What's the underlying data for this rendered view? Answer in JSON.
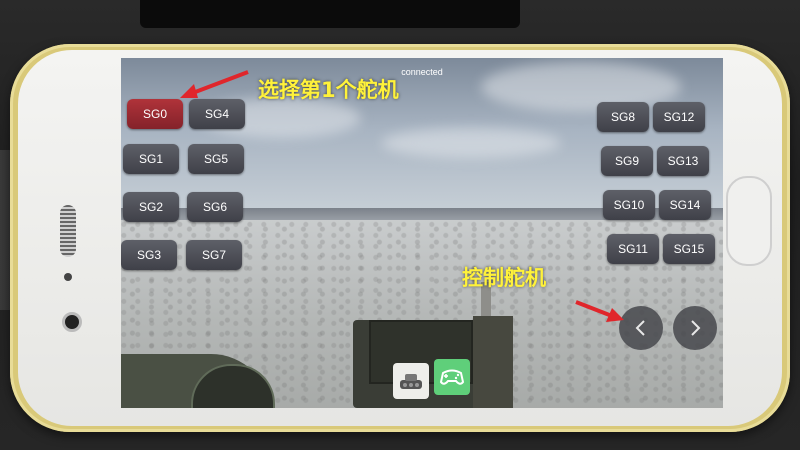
{
  "screen": {
    "status_text": "connected"
  },
  "left_buttons": [
    {
      "label": "SG0",
      "active": true
    },
    {
      "label": "SG4",
      "active": false
    },
    {
      "label": "SG1",
      "active": false
    },
    {
      "label": "SG5",
      "active": false
    },
    {
      "label": "SG2",
      "active": false
    },
    {
      "label": "SG6",
      "active": false
    },
    {
      "label": "SG3",
      "active": false
    },
    {
      "label": "SG7",
      "active": false
    }
  ],
  "right_buttons": [
    {
      "label": "SG8"
    },
    {
      "label": "SG12"
    },
    {
      "label": "SG9"
    },
    {
      "label": "SG13"
    },
    {
      "label": "SG10"
    },
    {
      "label": "SG14"
    },
    {
      "label": "SG11"
    },
    {
      "label": "SG15"
    }
  ],
  "controls": {
    "left_icon": "chevron-left-icon",
    "right_icon": "chevron-right-icon"
  },
  "toolbar": {
    "tank_icon": "tank-icon",
    "gamepad_icon": "gamepad-icon"
  },
  "annotations": {
    "select_servo": "选择第1个舵机",
    "control_servo": "控制舵机",
    "color": "#fff23a",
    "arrow_color": "#e0262b"
  },
  "colors": {
    "active_button": "#a62b32",
    "button": "#4e5058",
    "gamepad_tile": "#5fcf7a"
  }
}
